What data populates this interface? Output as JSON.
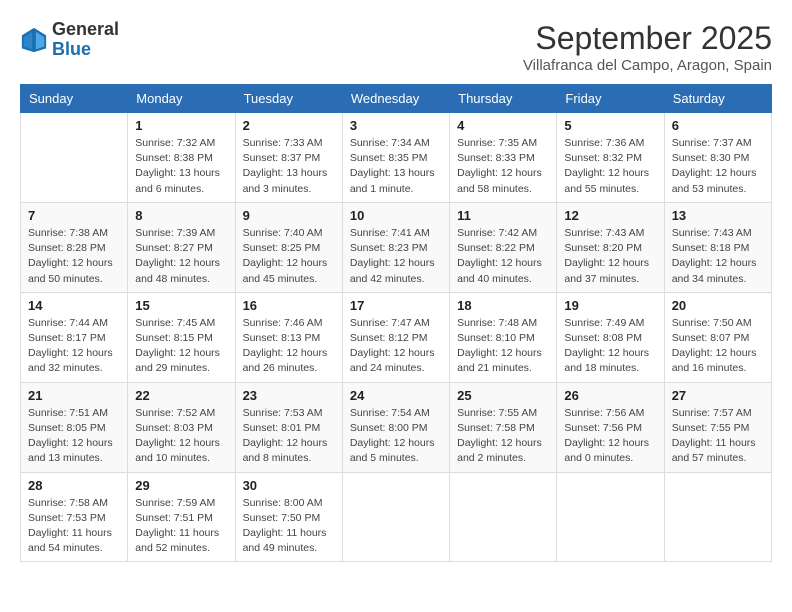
{
  "logo": {
    "general": "General",
    "blue": "Blue"
  },
  "header": {
    "month": "September 2025",
    "location": "Villafranca del Campo, Aragon, Spain"
  },
  "days_of_week": [
    "Sunday",
    "Monday",
    "Tuesday",
    "Wednesday",
    "Thursday",
    "Friday",
    "Saturday"
  ],
  "weeks": [
    [
      {
        "day": "",
        "info": ""
      },
      {
        "day": "1",
        "info": "Sunrise: 7:32 AM\nSunset: 8:38 PM\nDaylight: 13 hours\nand 6 minutes."
      },
      {
        "day": "2",
        "info": "Sunrise: 7:33 AM\nSunset: 8:37 PM\nDaylight: 13 hours\nand 3 minutes."
      },
      {
        "day": "3",
        "info": "Sunrise: 7:34 AM\nSunset: 8:35 PM\nDaylight: 13 hours\nand 1 minute."
      },
      {
        "day": "4",
        "info": "Sunrise: 7:35 AM\nSunset: 8:33 PM\nDaylight: 12 hours\nand 58 minutes."
      },
      {
        "day": "5",
        "info": "Sunrise: 7:36 AM\nSunset: 8:32 PM\nDaylight: 12 hours\nand 55 minutes."
      },
      {
        "day": "6",
        "info": "Sunrise: 7:37 AM\nSunset: 8:30 PM\nDaylight: 12 hours\nand 53 minutes."
      }
    ],
    [
      {
        "day": "7",
        "info": "Sunrise: 7:38 AM\nSunset: 8:28 PM\nDaylight: 12 hours\nand 50 minutes."
      },
      {
        "day": "8",
        "info": "Sunrise: 7:39 AM\nSunset: 8:27 PM\nDaylight: 12 hours\nand 48 minutes."
      },
      {
        "day": "9",
        "info": "Sunrise: 7:40 AM\nSunset: 8:25 PM\nDaylight: 12 hours\nand 45 minutes."
      },
      {
        "day": "10",
        "info": "Sunrise: 7:41 AM\nSunset: 8:23 PM\nDaylight: 12 hours\nand 42 minutes."
      },
      {
        "day": "11",
        "info": "Sunrise: 7:42 AM\nSunset: 8:22 PM\nDaylight: 12 hours\nand 40 minutes."
      },
      {
        "day": "12",
        "info": "Sunrise: 7:43 AM\nSunset: 8:20 PM\nDaylight: 12 hours\nand 37 minutes."
      },
      {
        "day": "13",
        "info": "Sunrise: 7:43 AM\nSunset: 8:18 PM\nDaylight: 12 hours\nand 34 minutes."
      }
    ],
    [
      {
        "day": "14",
        "info": "Sunrise: 7:44 AM\nSunset: 8:17 PM\nDaylight: 12 hours\nand 32 minutes."
      },
      {
        "day": "15",
        "info": "Sunrise: 7:45 AM\nSunset: 8:15 PM\nDaylight: 12 hours\nand 29 minutes."
      },
      {
        "day": "16",
        "info": "Sunrise: 7:46 AM\nSunset: 8:13 PM\nDaylight: 12 hours\nand 26 minutes."
      },
      {
        "day": "17",
        "info": "Sunrise: 7:47 AM\nSunset: 8:12 PM\nDaylight: 12 hours\nand 24 minutes."
      },
      {
        "day": "18",
        "info": "Sunrise: 7:48 AM\nSunset: 8:10 PM\nDaylight: 12 hours\nand 21 minutes."
      },
      {
        "day": "19",
        "info": "Sunrise: 7:49 AM\nSunset: 8:08 PM\nDaylight: 12 hours\nand 18 minutes."
      },
      {
        "day": "20",
        "info": "Sunrise: 7:50 AM\nSunset: 8:07 PM\nDaylight: 12 hours\nand 16 minutes."
      }
    ],
    [
      {
        "day": "21",
        "info": "Sunrise: 7:51 AM\nSunset: 8:05 PM\nDaylight: 12 hours\nand 13 minutes."
      },
      {
        "day": "22",
        "info": "Sunrise: 7:52 AM\nSunset: 8:03 PM\nDaylight: 12 hours\nand 10 minutes."
      },
      {
        "day": "23",
        "info": "Sunrise: 7:53 AM\nSunset: 8:01 PM\nDaylight: 12 hours\nand 8 minutes."
      },
      {
        "day": "24",
        "info": "Sunrise: 7:54 AM\nSunset: 8:00 PM\nDaylight: 12 hours\nand 5 minutes."
      },
      {
        "day": "25",
        "info": "Sunrise: 7:55 AM\nSunset: 7:58 PM\nDaylight: 12 hours\nand 2 minutes."
      },
      {
        "day": "26",
        "info": "Sunrise: 7:56 AM\nSunset: 7:56 PM\nDaylight: 12 hours\nand 0 minutes."
      },
      {
        "day": "27",
        "info": "Sunrise: 7:57 AM\nSunset: 7:55 PM\nDaylight: 11 hours\nand 57 minutes."
      }
    ],
    [
      {
        "day": "28",
        "info": "Sunrise: 7:58 AM\nSunset: 7:53 PM\nDaylight: 11 hours\nand 54 minutes."
      },
      {
        "day": "29",
        "info": "Sunrise: 7:59 AM\nSunset: 7:51 PM\nDaylight: 11 hours\nand 52 minutes."
      },
      {
        "day": "30",
        "info": "Sunrise: 8:00 AM\nSunset: 7:50 PM\nDaylight: 11 hours\nand 49 minutes."
      },
      {
        "day": "",
        "info": ""
      },
      {
        "day": "",
        "info": ""
      },
      {
        "day": "",
        "info": ""
      },
      {
        "day": "",
        "info": ""
      }
    ]
  ]
}
